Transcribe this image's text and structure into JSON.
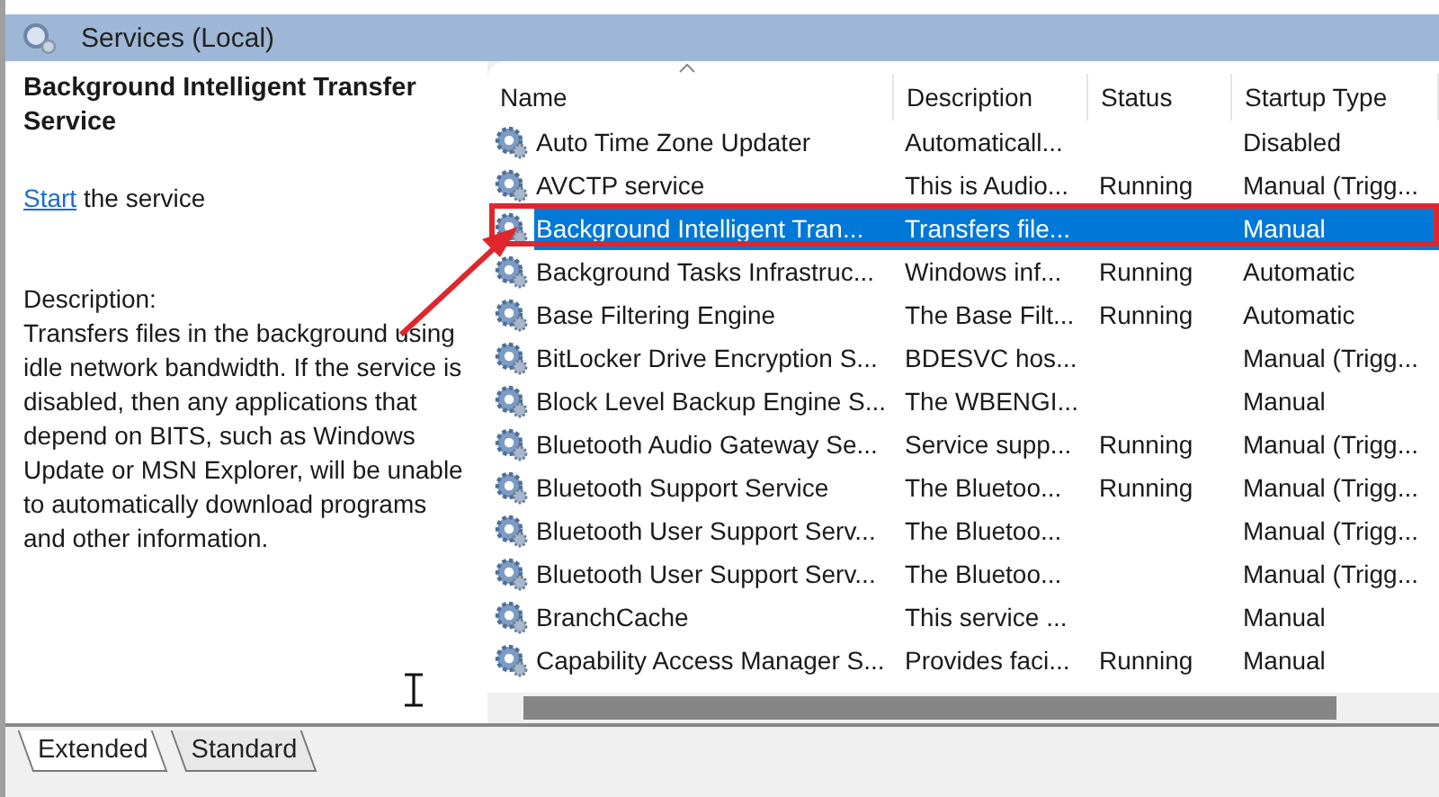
{
  "window": {
    "title": "Services (Local)"
  },
  "detail": {
    "title": "Background Intelligent Transfer Service",
    "action": {
      "link": "Start",
      "rest": "the service"
    },
    "description_label": "Description:",
    "description": "Transfers files in the background using idle network bandwidth. If the service is disabled, then any applications that depend on BITS, such as Windows Update or MSN Explorer, will be unable to automatically download programs and other information."
  },
  "table": {
    "columns": [
      {
        "label": "Name",
        "sorted": true
      },
      {
        "label": "Description",
        "sorted": false
      },
      {
        "label": "Status",
        "sorted": false
      },
      {
        "label": "Startup Type",
        "sorted": false
      }
    ],
    "rows": [
      {
        "name": "Auto Time Zone Updater",
        "description": "Automaticall...",
        "startup_type": "Disabled",
        "selected": false,
        "highlighted": false
      },
      {
        "name": "AVCTP service",
        "description": "This is Audio...",
        "status": "Running",
        "startup_type": "Manual (Trigg...",
        "selected": false,
        "highlighted": false
      },
      {
        "name": "Background Intelligent Tran...",
        "description": "Transfers file...",
        "startup_type": "Manual",
        "selected": true,
        "highlighted": true
      },
      {
        "name": "Background Tasks Infrastruc...",
        "description": "Windows inf...",
        "status": "Running",
        "startup_type": "Automatic",
        "selected": false,
        "highlighted": false
      },
      {
        "name": "Base Filtering Engine",
        "description": "The Base Filt...",
        "status": "Running",
        "startup_type": "Automatic",
        "selected": false,
        "highlighted": false
      },
      {
        "name": "BitLocker Drive Encryption S...",
        "description": "BDESVC hos...",
        "startup_type": "Manual (Trigg...",
        "selected": false,
        "highlighted": false
      },
      {
        "name": "Block Level Backup Engine S...",
        "description": "The WBENGI...",
        "startup_type": "Manual",
        "selected": false,
        "highlighted": false
      },
      {
        "name": "Bluetooth Audio Gateway Se...",
        "description": "Service supp...",
        "status": "Running",
        "startup_type": "Manual (Trigg...",
        "selected": false,
        "highlighted": false
      },
      {
        "name": "Bluetooth Support Service",
        "description": "The Bluetoo...",
        "status": "Running",
        "startup_type": "Manual (Trigg...",
        "selected": false,
        "highlighted": false
      },
      {
        "name": "Bluetooth User Support Serv...",
        "description": "The Bluetoo...",
        "startup_type": "Manual (Trigg...",
        "selected": false,
        "highlighted": false
      },
      {
        "name": "Bluetooth User Support Serv...",
        "description": "The Bluetoo...",
        "startup_type": "Manual (Trigg...",
        "selected": false,
        "highlighted": false
      },
      {
        "name": "BranchCache",
        "description": "This service ...",
        "startup_type": "Manual",
        "selected": false,
        "highlighted": false
      },
      {
        "name": "Capability Access Manager S...",
        "description": "Provides faci...",
        "status": "Running",
        "startup_type": "Manual",
        "selected": false,
        "highlighted": false
      }
    ]
  },
  "tabs": [
    {
      "label": "Extended",
      "selected": true
    },
    {
      "label": "Standard",
      "selected": false
    }
  ]
}
